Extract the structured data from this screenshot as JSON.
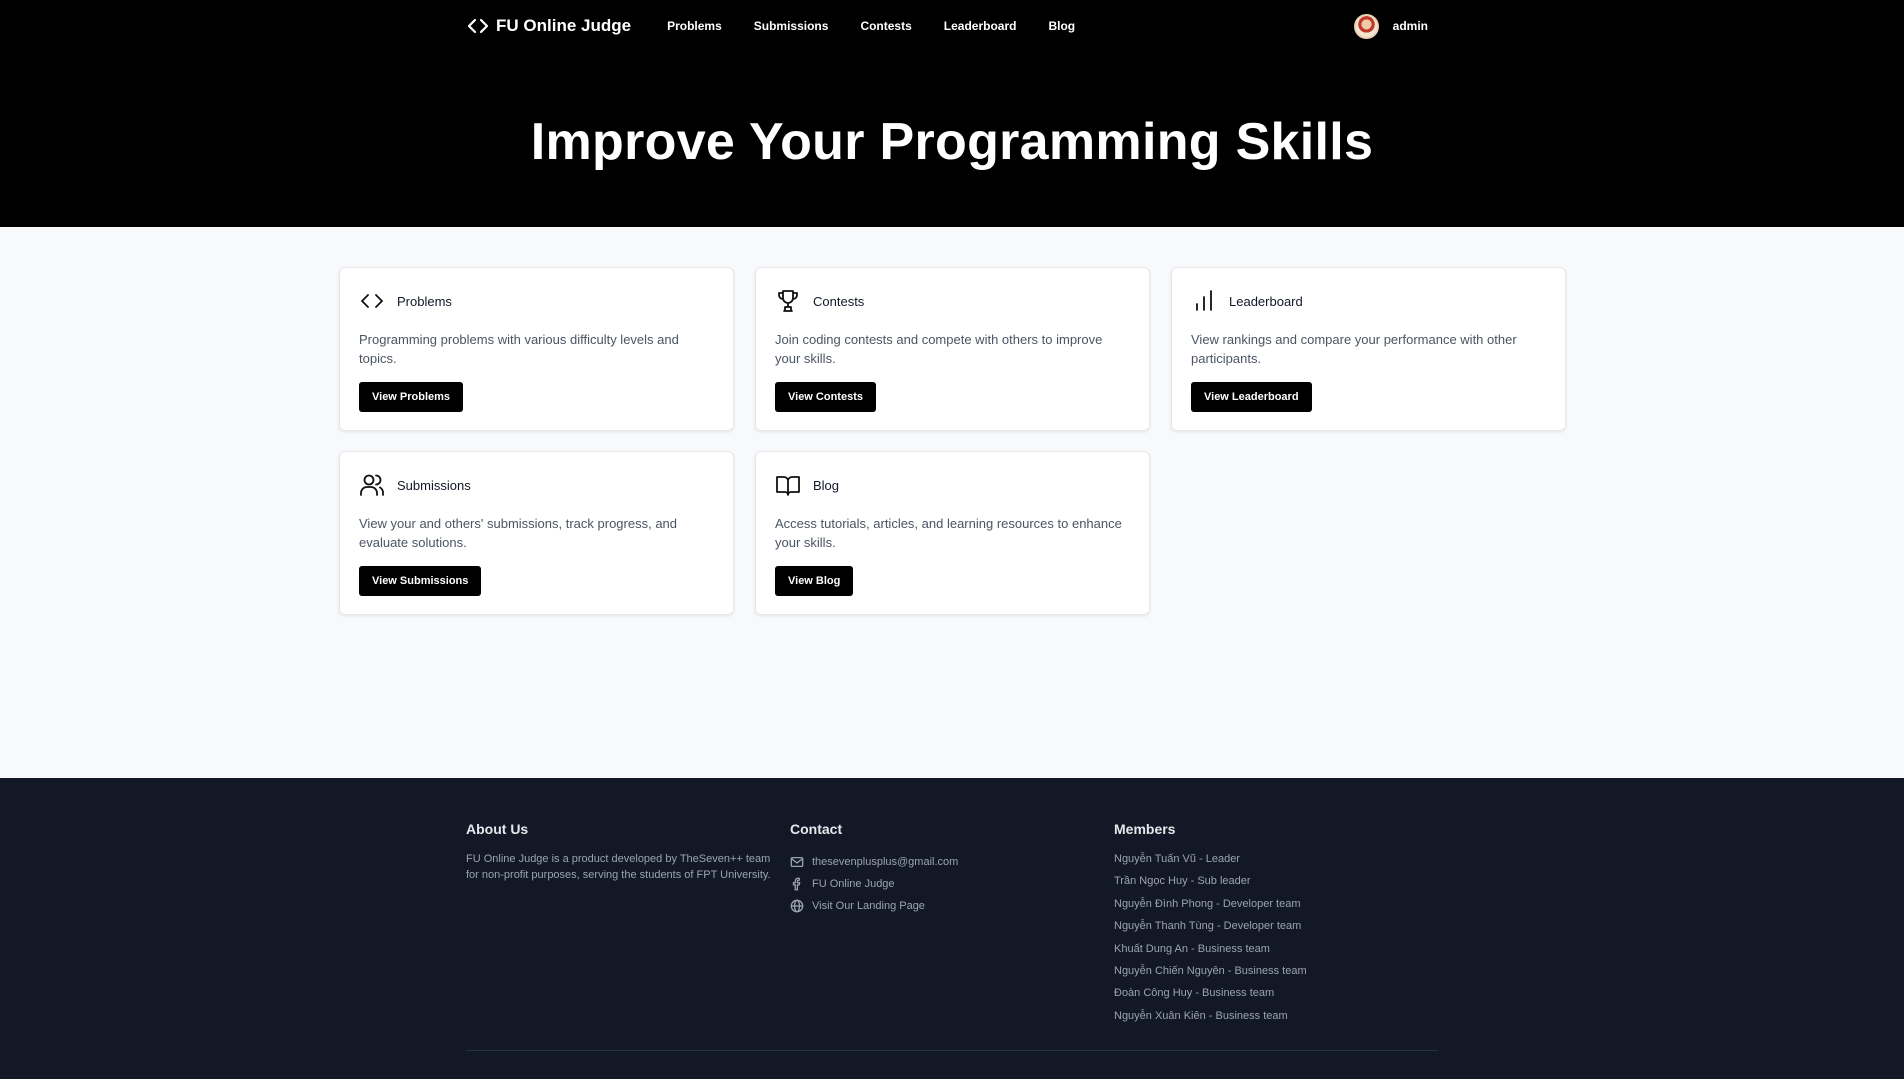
{
  "header": {
    "brand": "FU Online Judge",
    "nav": [
      "Problems",
      "Submissions",
      "Contests",
      "Leaderboard",
      "Blog"
    ],
    "user": "admin"
  },
  "hero": {
    "title": "Improve Your Programming Skills"
  },
  "cards": [
    {
      "icon": "code-icon",
      "title": "Problems",
      "desc": "Programming problems with various difficulty levels and topics.",
      "button": "View Problems"
    },
    {
      "icon": "trophy-icon",
      "title": "Contests",
      "desc": "Join coding contests and compete with others to improve your skills.",
      "button": "View Contests"
    },
    {
      "icon": "bar-chart-icon",
      "title": "Leaderboard",
      "desc": "View rankings and compare your performance with other participants.",
      "button": "View Leaderboard"
    },
    {
      "icon": "users-icon",
      "title": "Submissions",
      "desc": "View your and others' submissions, track progress, and evaluate solutions.",
      "button": "View Submissions"
    },
    {
      "icon": "book-icon",
      "title": "Blog",
      "desc": "Access tutorials, articles, and learning resources to enhance your skills.",
      "button": "View Blog"
    }
  ],
  "footer": {
    "about": {
      "heading": "About Us",
      "text": "FU Online Judge is a product developed by TheSeven++ team for non-profit purposes, serving the students of FPT University."
    },
    "contact": {
      "heading": "Contact",
      "items": [
        {
          "icon": "mail-icon",
          "label": "thesevenplusplus@gmail.com"
        },
        {
          "icon": "facebook-icon",
          "label": "FU Online Judge"
        },
        {
          "icon": "globe-icon",
          "label": "Visit Our Landing Page"
        }
      ]
    },
    "members": {
      "heading": "Members",
      "items": [
        "Nguyễn Tuấn Vũ - Leader",
        "Trần Ngọc Huy - Sub leader",
        "Nguyễn Đình Phong - Developer team",
        "Nguyễn Thanh Tùng - Developer team",
        "Khuất Dung An - Business team",
        "Nguyễn Chiến Nguyên - Business team",
        "Đoàn Công Huy - Business team",
        "Nguyễn Xuân Kiên - Business team"
      ]
    }
  }
}
